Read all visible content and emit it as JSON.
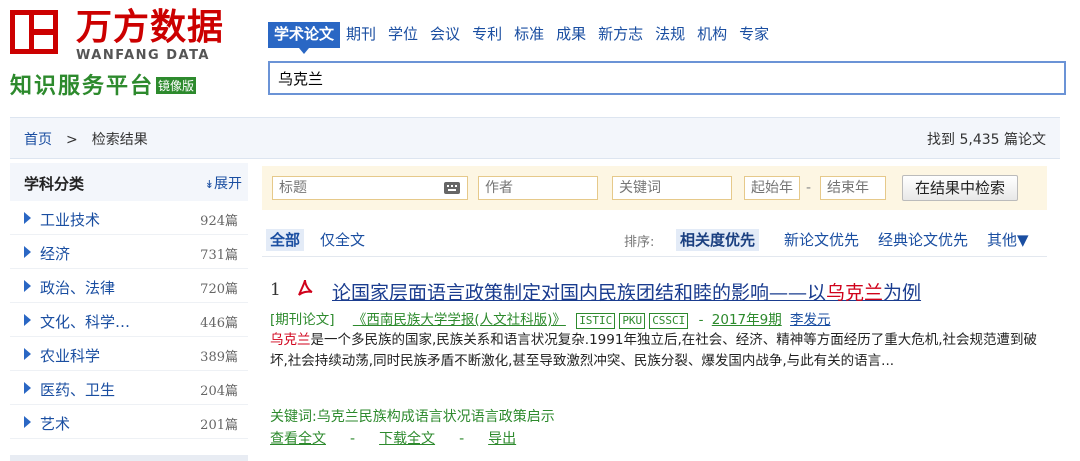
{
  "logo": {
    "brand_cn": "万方数据",
    "brand_en": "WANFANG DATA",
    "platform": "知识服务平台",
    "platform_badge": "镜像版"
  },
  "search": {
    "tabs": [
      "学术论文",
      "期刊",
      "学位",
      "会议",
      "专利",
      "标准",
      "成果",
      "新方志",
      "法规",
      "机构",
      "专家"
    ],
    "active_tab": "学术论文",
    "query": "乌克兰"
  },
  "breadcrumb": {
    "home": "首页",
    "sep": ">",
    "current": "检索结果"
  },
  "result_count": "找到 5,435 篇论文",
  "sidebar": {
    "title": "学科分类",
    "expand": "展开",
    "categories": [
      {
        "name": "工业技术",
        "count": "924篇"
      },
      {
        "name": "经济",
        "count": "731篇"
      },
      {
        "name": "政治、法律",
        "count": "720篇"
      },
      {
        "name": "文化、科学…",
        "count": "446篇"
      },
      {
        "name": "农业科学",
        "count": "389篇"
      },
      {
        "name": "医药、卫生",
        "count": "204篇"
      },
      {
        "name": "艺术",
        "count": "201篇"
      }
    ]
  },
  "filter": {
    "title_placeholder": "标题",
    "author_placeholder": "作者",
    "keyword_placeholder": "关键词",
    "start_year_placeholder": "起始年",
    "year_sep": "-",
    "end_year_placeholder": "结束年",
    "search_in_results": "在结果中检索"
  },
  "sort": {
    "all": "全部",
    "fulltext_only": "仅全文",
    "label": "排序:",
    "options": [
      "相关度优先",
      "新论文优先",
      "经典论文优先",
      "其他▼"
    ],
    "active": "相关度优先"
  },
  "results": [
    {
      "number": "1",
      "title_prefix": "论国家层面语言政策制定对国内民族团结和睦的影响——以",
      "title_highlight": "乌克兰",
      "title_suffix": "为例",
      "type": "[期刊论文]",
      "journal": "《西南民族大学学报(人文社科版)》",
      "indexes": [
        "ISTIC",
        "PKU",
        "CSSCI"
      ],
      "meta_sep": "-",
      "date": "2017年9期",
      "author": "李发元",
      "abstract_highlight": "乌克兰",
      "abstract_rest": "是一个多民族的国家,民族关系和语言状况复杂.1991年独立后,在社会、经济、精神等方面经历了重大危机,社会规范遭到破坏,社会持续动荡,同时民族矛盾不断激化,甚至导致激烈冲突、民族分裂、爆发国内战争,与此有关的语言...",
      "keywords_label": "关键词:",
      "keywords": [
        "乌克兰",
        "民族构成",
        "语言状况",
        "语言政策",
        "启示"
      ],
      "actions": [
        "查看全文",
        "下载全文",
        "导出"
      ],
      "action_sep": "-"
    }
  ],
  "colors": {
    "brand_red": "#c00000",
    "brand_green": "#2d8a2d",
    "link_blue": "#1a4ea1",
    "highlight_red": "#d0021b"
  }
}
